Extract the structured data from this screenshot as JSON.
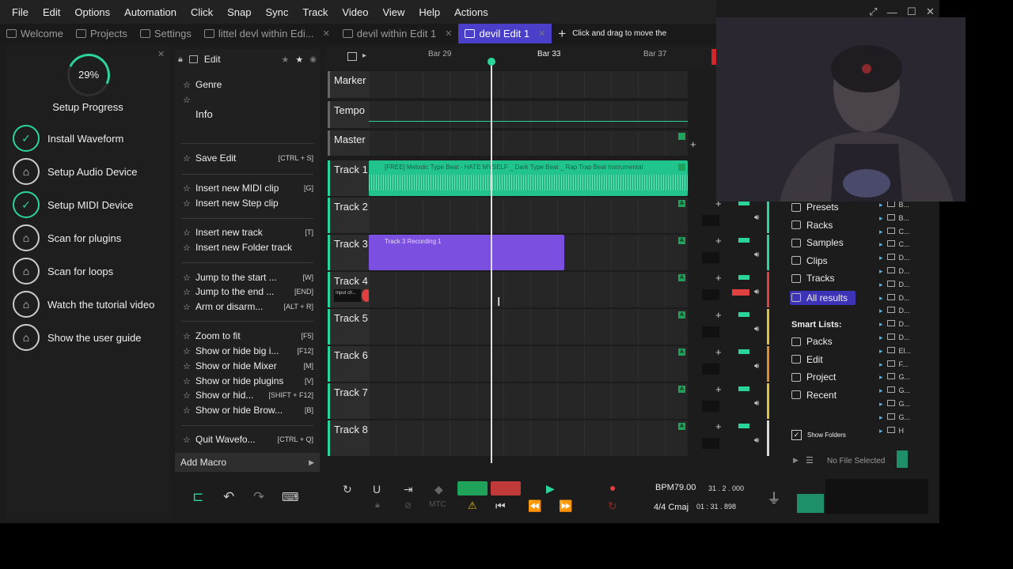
{
  "menu": [
    "File",
    "Edit",
    "Options",
    "Automation",
    "Click",
    "Snap",
    "Sync",
    "Track",
    "Video",
    "View",
    "Help",
    "Actions"
  ],
  "tabs": [
    {
      "label": "Welcome",
      "closable": false,
      "active": false
    },
    {
      "label": "Projects",
      "closable": false,
      "active": false
    },
    {
      "label": "Settings",
      "closable": false,
      "active": false
    },
    {
      "label": "littel devl within Edi...",
      "closable": true,
      "active": false
    },
    {
      "label": "devil within Edit 1",
      "closable": true,
      "active": false
    },
    {
      "label": "devil Edit 1",
      "closable": true,
      "active": true
    }
  ],
  "hint": "Click and drag to move the",
  "setup": {
    "progress": "29%",
    "title": "Setup Progress",
    "steps": [
      {
        "label": "Install Waveform",
        "done": true
      },
      {
        "label": "Setup Audio Device",
        "done": false
      },
      {
        "label": "Setup MIDI Device",
        "done": true
      },
      {
        "label": "Scan for plugins",
        "done": false
      },
      {
        "label": "Scan for loops",
        "done": false
      },
      {
        "label": "Watch the tutorial video",
        "done": false
      },
      {
        "label": "Show the user guide",
        "done": false
      }
    ]
  },
  "edit_panel": {
    "title": "Edit",
    "genre": "Genre",
    "info": "Info",
    "items": [
      {
        "label": "Save Edit",
        "shortcut": "[CTRL + S]"
      },
      {
        "label": "Insert new MIDI clip",
        "shortcut": "[G]"
      },
      {
        "label": "Insert new Step clip",
        "shortcut": ""
      },
      {
        "label": "Insert new track",
        "shortcut": "[T]"
      },
      {
        "label": "Insert new Folder track",
        "shortcut": ""
      },
      {
        "label": "Jump to the start ...",
        "shortcut": "[W]"
      },
      {
        "label": "Jump to the end ...",
        "shortcut": "[END]"
      },
      {
        "label": "Arm or disarm...",
        "shortcut": "[ALT + R]"
      },
      {
        "label": "Zoom to fit",
        "shortcut": "[F5]"
      },
      {
        "label": "Show or hide big i...",
        "shortcut": "[F12]"
      },
      {
        "label": "Show or hide Mixer",
        "shortcut": "[M]"
      },
      {
        "label": "Show or hide plugins",
        "shortcut": "[V]"
      },
      {
        "label": "Show or hid...",
        "shortcut": "[SHIFT + F12]"
      },
      {
        "label": "Show or hide Brow...",
        "shortcut": "[B]"
      },
      {
        "label": "Quit Wavefo...",
        "shortcut": "[CTRL + Q]"
      }
    ],
    "add_macro": "Add Macro"
  },
  "ruler": {
    "bars": [
      "Bar 29",
      "Bar 33",
      "Bar 37"
    ]
  },
  "tracks": [
    {
      "name": "Marker"
    },
    {
      "name": "Tempo"
    },
    {
      "name": "Master"
    },
    {
      "name": "Track 1",
      "clip": "[FREE] Melodic Type Beat - HATE MYSELF _ Dark Type Beat _ Rap Trap Beat Instrumental"
    },
    {
      "name": "Track 2"
    },
    {
      "name": "Track 3",
      "clip": "Track 3 Recording 1"
    },
    {
      "name": "Track 4",
      "input": "Input ch..."
    },
    {
      "name": "Track 5"
    },
    {
      "name": "Track 6"
    },
    {
      "name": "Track 7"
    },
    {
      "name": "Track 8"
    }
  ],
  "track_colors": [
    "#2bd59a",
    "#2bd59a",
    "#2bd59a",
    "#e04040",
    "#d9c23a",
    "#e08a2a",
    "#e0c040",
    "#d8d8d8"
  ],
  "browser": {
    "items": [
      "Presets",
      "Racks",
      "Samples",
      "Clips",
      "Tracks",
      "All results"
    ],
    "smart_lists_label": "Smart Lists:",
    "smart": [
      "Packs",
      "Edit",
      "Project",
      "Recent"
    ],
    "show_folders": "Show Folders",
    "no_file": "No File Selected",
    "folders": [
      "B...",
      "B...",
      "C...",
      "C...",
      "D...",
      "D...",
      "D...",
      "D...",
      "D...",
      "D...",
      "D...",
      "El...",
      "F...",
      "G...",
      "G...",
      "G...",
      "G...",
      "H"
    ]
  },
  "transport": {
    "bpm": "BPM79.00",
    "position": "31 . 2 . 000",
    "signature": "4/4  Cmaj",
    "time": "01 : 31 . 898",
    "mtc": "MTC"
  },
  "colors": {
    "accent": "#4a3fc9",
    "green": "#2bd59a",
    "record": "#e04040"
  }
}
